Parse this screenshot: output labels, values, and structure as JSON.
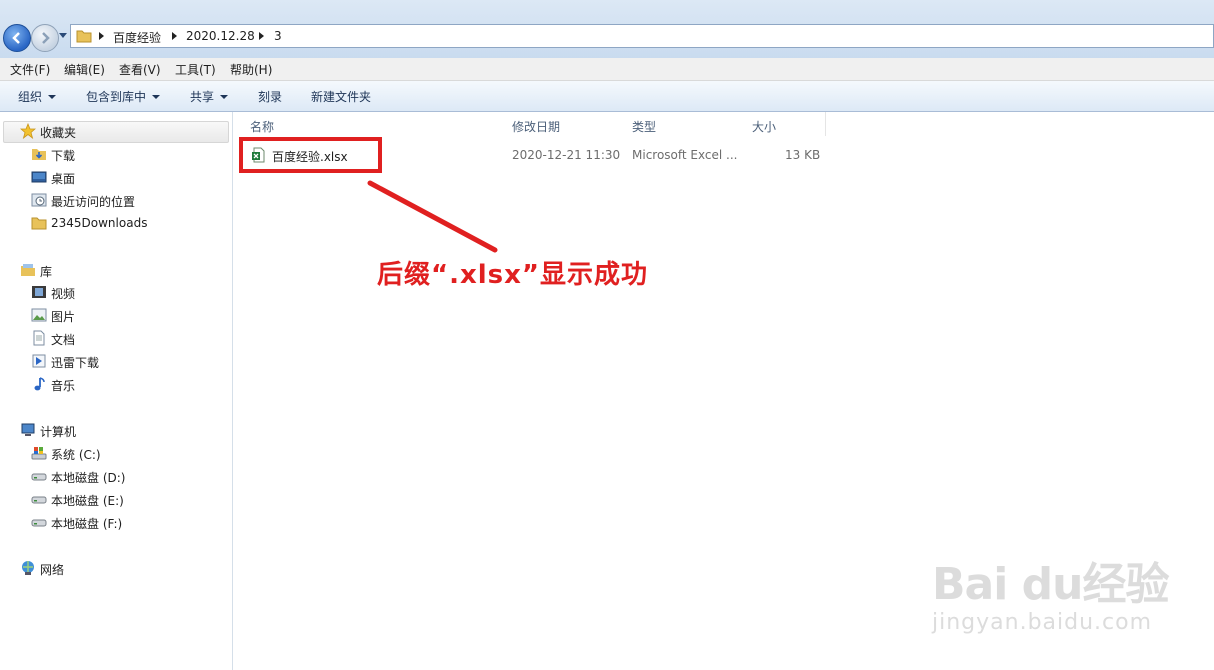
{
  "address": {
    "crumbs": [
      "百度经验",
      "2020.12.28",
      "3"
    ]
  },
  "menu": {
    "items": [
      "文件(F)",
      "编辑(E)",
      "查看(V)",
      "工具(T)",
      "帮助(H)"
    ]
  },
  "toolbar": {
    "organize": "组织",
    "include_library": "包含到库中",
    "share": "共享",
    "burn": "刻录",
    "new_folder": "新建文件夹"
  },
  "sidebar": {
    "favorites": {
      "title": "收藏夹",
      "items": [
        "下载",
        "桌面",
        "最近访问的位置",
        "2345Downloads"
      ]
    },
    "libraries": {
      "title": "库",
      "items": [
        "视频",
        "图片",
        "文档",
        "迅雷下载",
        "音乐"
      ]
    },
    "computer": {
      "title": "计算机",
      "items": [
        "系统 (C:)",
        "本地磁盘 (D:)",
        "本地磁盘 (E:)",
        "本地磁盘 (F:)"
      ]
    },
    "network": {
      "title": "网络"
    }
  },
  "columns": {
    "name": "名称",
    "modified": "修改日期",
    "type": "类型",
    "size": "大小"
  },
  "files": [
    {
      "name": "百度经验.xlsx",
      "modified": "2020-12-21 11:30",
      "type": "Microsoft Excel ...",
      "size": "13 KB"
    }
  ],
  "annotation": {
    "text": "后缀“.xlsx”显示成功",
    "color": "#e02020"
  },
  "watermark": {
    "logo": "Bai du经验",
    "url": "jingyan.baidu.com"
  }
}
